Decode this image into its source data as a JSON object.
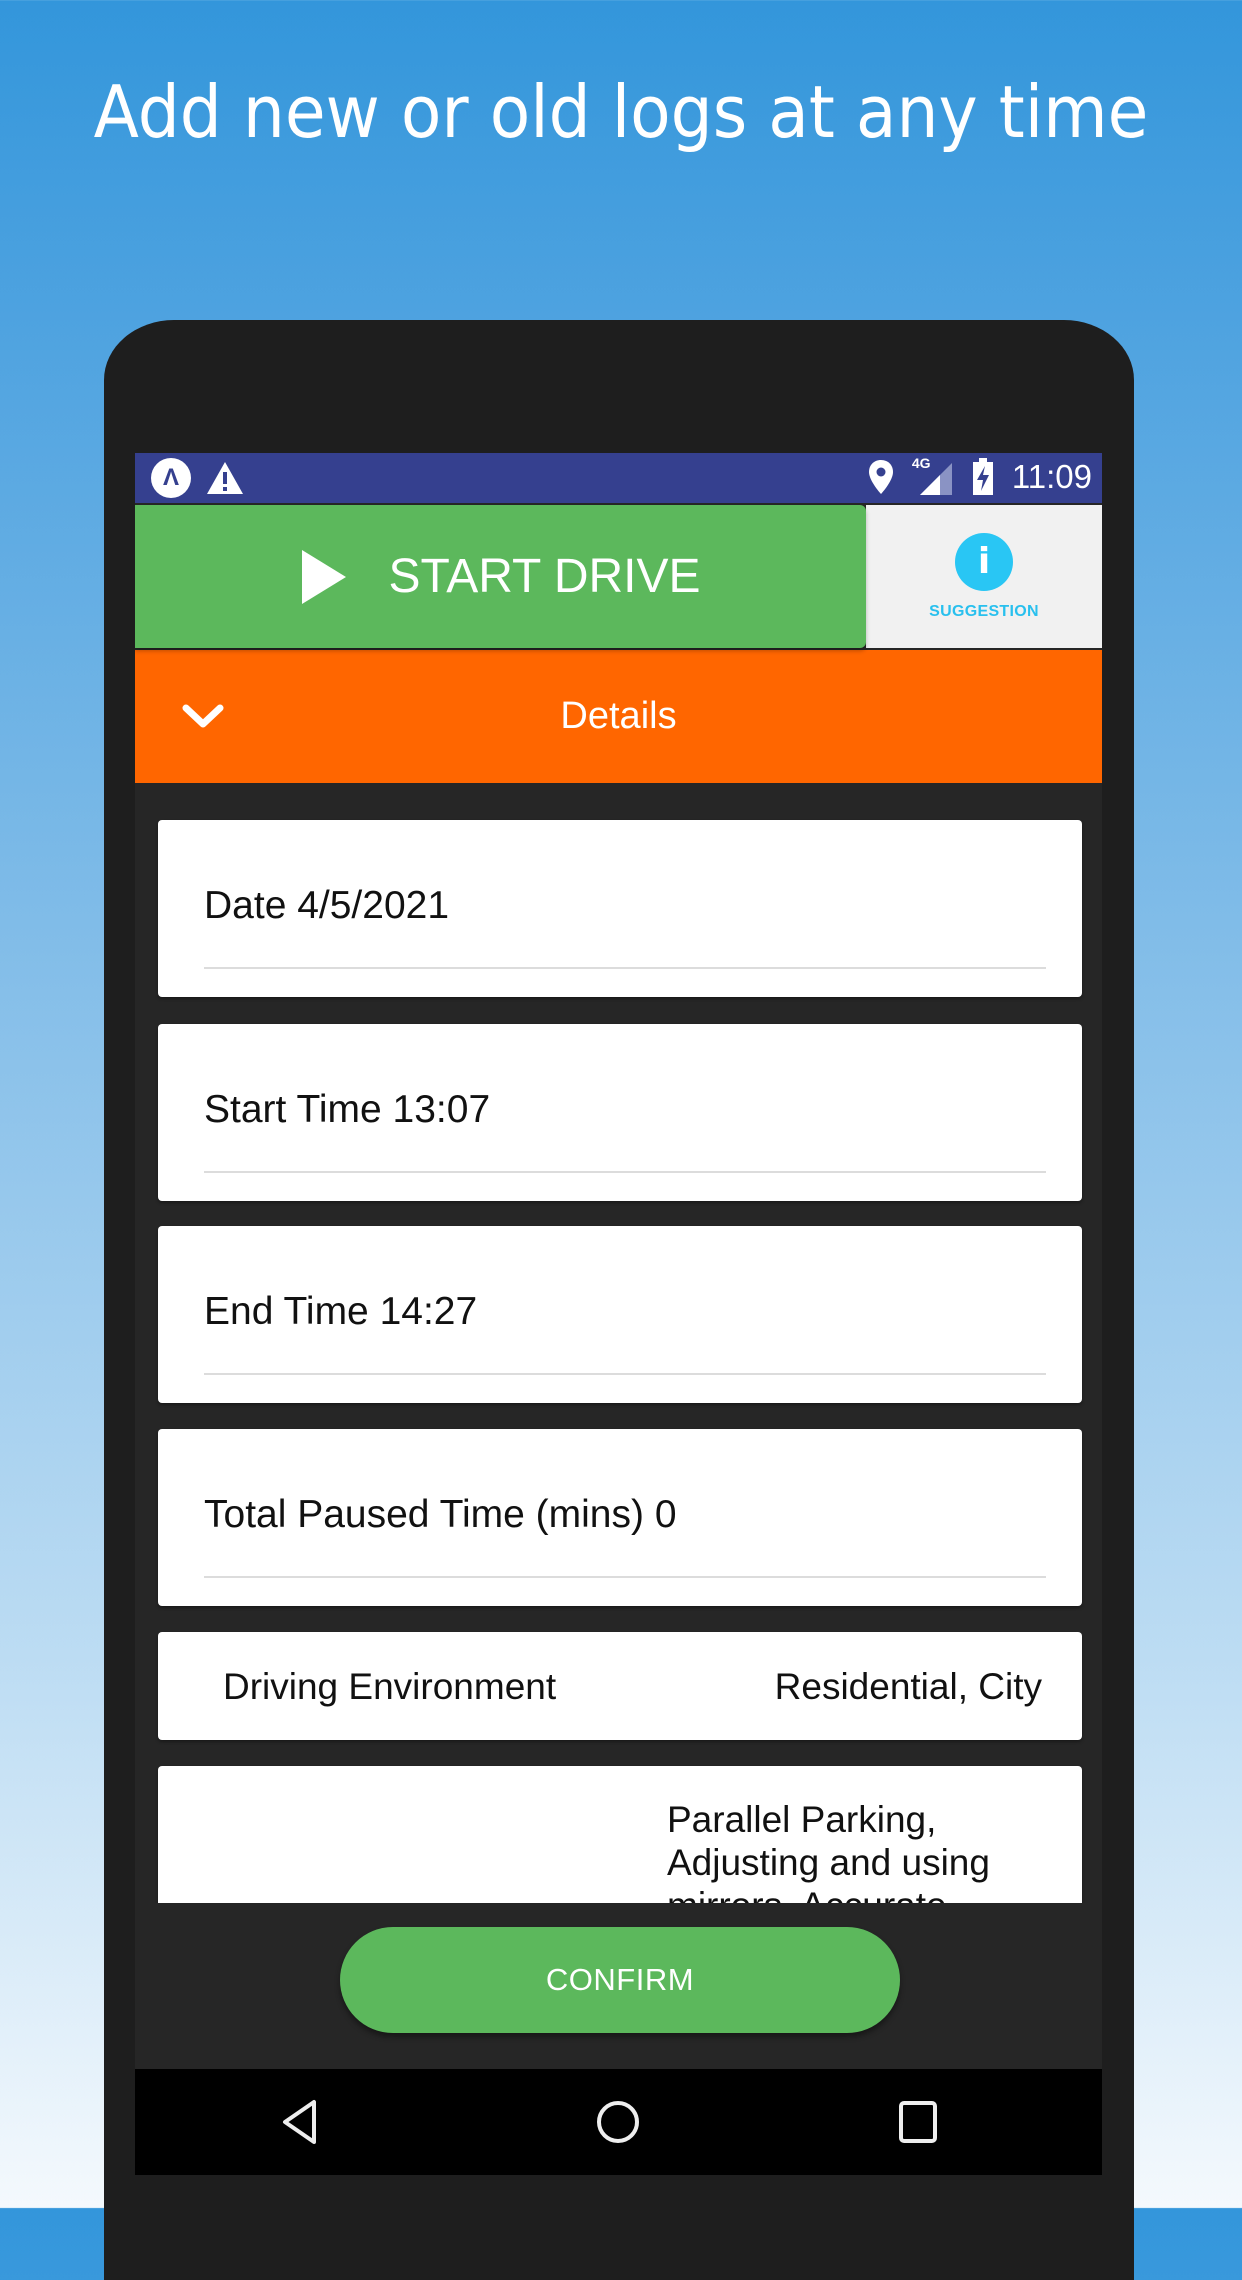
{
  "headline": "Add new or old logs at any time",
  "status_bar": {
    "left_icons": [
      "app-notification-icon",
      "warning-icon"
    ],
    "right_icons": [
      "location-icon",
      "signal-4g-icon",
      "battery-charging-icon"
    ],
    "network_label": "4G",
    "time": "11:09",
    "app_icon_glyph": "Λ"
  },
  "start_drive": {
    "label": "START DRIVE",
    "icon": "play-icon"
  },
  "suggestion": {
    "label": "SUGGESTION",
    "icon_glyph": "i"
  },
  "details_bar": {
    "title": "Details",
    "icon": "chevron-down-icon"
  },
  "fields": [
    {
      "label": "Date",
      "value": "4/5/2021",
      "text": "Date 4/5/2021"
    },
    {
      "label": "Start Time",
      "value": "13:07",
      "text": "Start Time 13:07"
    },
    {
      "label": "End Time",
      "value": "14:27",
      "text": "End Time 14:27"
    },
    {
      "label": "Total Paused Time (mins)",
      "value": "0",
      "text": "Total Paused Time (mins) 0"
    }
  ],
  "driving_environment": {
    "label": "Driving Environment",
    "value": "Residential, City"
  },
  "skills": {
    "value": "Parallel Parking, Adjusting and using mirrors, Accurate"
  },
  "confirm_label": "CONFIRM",
  "colors": {
    "status_bar": "#35408f",
    "start_green": "#5cb85c",
    "details_orange": "#ff6600",
    "suggestion_blue": "#29c6f4",
    "content_bg": "#262626"
  }
}
